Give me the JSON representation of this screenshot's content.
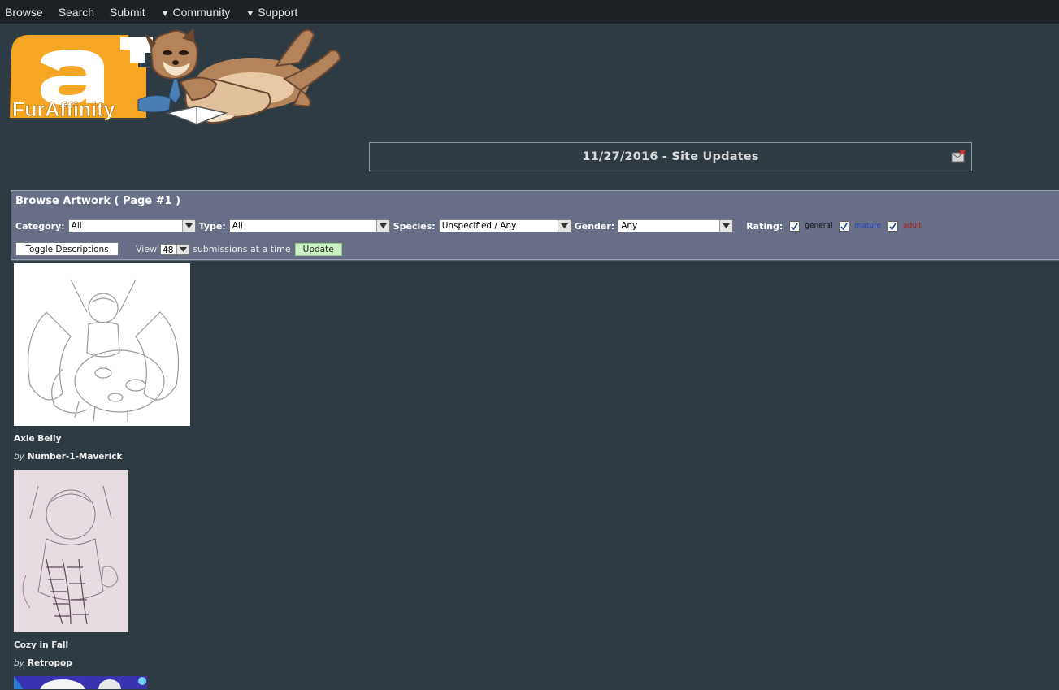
{
  "nav": {
    "items": [
      {
        "label": "Browse",
        "dropdown": false
      },
      {
        "label": "Search",
        "dropdown": false
      },
      {
        "label": "Submit",
        "dropdown": false
      },
      {
        "label": "Community",
        "dropdown": true
      },
      {
        "label": "Support",
        "dropdown": true
      }
    ]
  },
  "logo": {
    "text": "FurAffinity"
  },
  "site_update": {
    "title": "11/27/2016 - Site Updates"
  },
  "browse": {
    "title": "Browse Artwork ( Page #1 )",
    "filters": {
      "category_label": "Category:",
      "category_value": "All",
      "type_label": "Type:",
      "type_value": "All",
      "species_label": "Species:",
      "species_value": "Unspecified / Any",
      "gender_label": "Gender:",
      "gender_value": "Any",
      "rating_label": "Rating:",
      "ratings": [
        {
          "label": "general",
          "checked": true
        },
        {
          "label": "mature",
          "checked": true
        },
        {
          "label": "adult",
          "checked": true
        }
      ]
    },
    "toggle_descriptions": "Toggle Descriptions",
    "view_label": "View",
    "per_page": "48",
    "per_page_suffix": "submissions at a time",
    "update_label": "Update"
  },
  "submissions": [
    {
      "title": "Axle Belly",
      "by": "by",
      "artist": "Number-1-Maverick"
    },
    {
      "title": "Cozy in Fall",
      "by": "by",
      "artist": "Retropop"
    }
  ],
  "colors": {
    "page_bg": "#2e3b43",
    "nav_bg": "#1d2024",
    "panel_bg": "#686e86",
    "update_btn_bg": "#c8f0c0",
    "logo_orange": "#f5a623"
  }
}
